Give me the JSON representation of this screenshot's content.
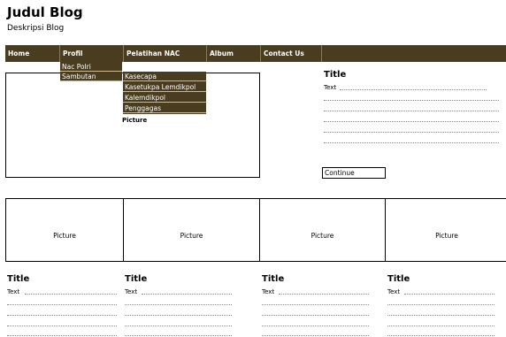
{
  "header": {
    "title": "Judul Blog",
    "description": "Deskripsi Blog"
  },
  "nav": {
    "items": [
      "Home",
      "Profil",
      "Pelatihan NAC",
      "Album",
      "Contact Us"
    ],
    "profil_menu": [
      "Nac Polri",
      "Sambutan"
    ],
    "pelatihan_menu": [
      "Kasecapa",
      "Kasetukpa Lemdikpol",
      "Kalemdikpol",
      "Penggagas"
    ]
  },
  "feature": {
    "picture": "Picture"
  },
  "side": {
    "title": "Title",
    "text": "Text",
    "continue": "Continue"
  },
  "gallery": [
    "Picture",
    "Picture",
    "Picture",
    "Picture"
  ],
  "columns": [
    {
      "title": "Title",
      "text": "Text"
    },
    {
      "title": "Title",
      "text": "Text"
    },
    {
      "title": "Title",
      "text": "Text"
    },
    {
      "title": "Title",
      "text": "Text"
    }
  ],
  "colors": {
    "nav_bg": "#4a3d1f",
    "nav_text": "#ffffff"
  }
}
